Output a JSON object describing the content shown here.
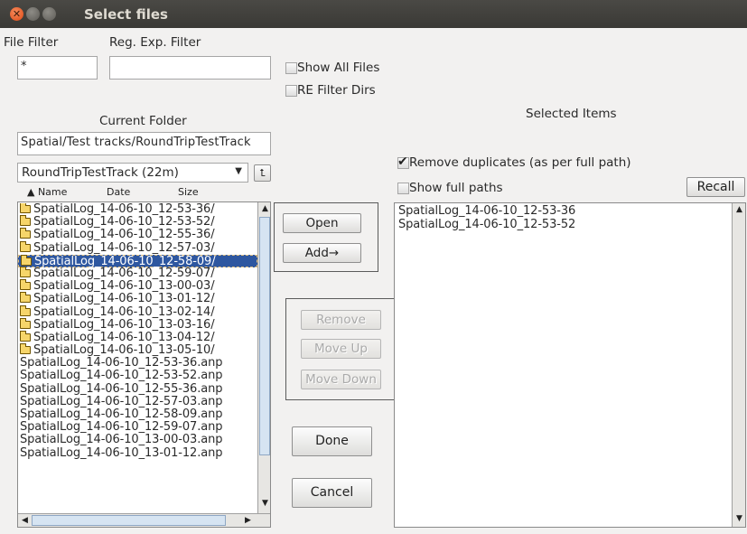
{
  "window": {
    "title": "Select files",
    "close_glyph": "✕"
  },
  "filters": {
    "file_filter_label": "File Filter",
    "regexp_filter_label": "Reg. Exp. Filter",
    "file_filter_value": "*",
    "regexp_filter_value": "",
    "show_all_files_label": "Show All Files",
    "show_all_files_checked": false,
    "re_filter_dirs_label": "RE Filter Dirs",
    "re_filter_dirs_checked": false
  },
  "current_folder": {
    "label": "Current Folder",
    "path": "Spatial/Test tracks/RoundTripTestTrack",
    "combo_value": "RoundTripTestTrack (22m)",
    "combo_arrow": "▼",
    "up_button_glyph": "⮤"
  },
  "file_list": {
    "columns": [
      "▲ Name",
      "Date",
      "Size"
    ],
    "rows": [
      {
        "text": "SpatialLog_14-06-10_12-53-36/",
        "folder": true,
        "selected": false
      },
      {
        "text": "SpatialLog_14-06-10_12-53-52/",
        "folder": true,
        "selected": false
      },
      {
        "text": "SpatialLog_14-06-10_12-55-36/",
        "folder": true,
        "selected": false
      },
      {
        "text": "SpatialLog_14-06-10_12-57-03/",
        "folder": true,
        "selected": false
      },
      {
        "text": "SpatialLog_14-06-10_12-58-09/",
        "folder": true,
        "selected": true
      },
      {
        "text": "SpatialLog_14-06-10_12-59-07/",
        "folder": true,
        "selected": false
      },
      {
        "text": "SpatialLog_14-06-10_13-00-03/",
        "folder": true,
        "selected": false
      },
      {
        "text": "SpatialLog_14-06-10_13-01-12/",
        "folder": true,
        "selected": false
      },
      {
        "text": "SpatialLog_14-06-10_13-02-14/",
        "folder": true,
        "selected": false
      },
      {
        "text": "SpatialLog_14-06-10_13-03-16/",
        "folder": true,
        "selected": false
      },
      {
        "text": "SpatialLog_14-06-10_13-04-12/",
        "folder": true,
        "selected": false
      },
      {
        "text": "SpatialLog_14-06-10_13-05-10/",
        "folder": true,
        "selected": false
      },
      {
        "text": "SpatialLog_14-06-10_12-53-36.anp",
        "folder": false,
        "selected": false
      },
      {
        "text": "SpatialLog_14-06-10_12-53-52.anp",
        "folder": false,
        "selected": false
      },
      {
        "text": "SpatialLog_14-06-10_12-55-36.anp",
        "folder": false,
        "selected": false
      },
      {
        "text": "SpatialLog_14-06-10_12-57-03.anp",
        "folder": false,
        "selected": false
      },
      {
        "text": "SpatialLog_14-06-10_12-58-09.anp",
        "folder": false,
        "selected": false
      },
      {
        "text": "SpatialLog_14-06-10_12-59-07.anp",
        "folder": false,
        "selected": false
      },
      {
        "text": "SpatialLog_14-06-10_13-00-03.anp",
        "folder": false,
        "selected": false
      },
      {
        "text": "SpatialLog_14-06-10_13-01-12.anp",
        "folder": false,
        "selected": false
      }
    ]
  },
  "actions": {
    "open_label": "Open",
    "add_label": "Add→",
    "remove_label": "Remove",
    "move_up_label": "Move Up",
    "move_down_label": "Move Down",
    "done_label": "Done",
    "cancel_label": "Cancel"
  },
  "selected": {
    "title": "Selected Items",
    "remove_duplicates_label": "Remove duplicates (as per full path)",
    "remove_duplicates_checked": true,
    "show_full_paths_label": "Show full paths",
    "show_full_paths_checked": false,
    "recall_label": "Recall",
    "items": [
      "SpatialLog_14-06-10_12-53-36",
      "SpatialLog_14-06-10_12-53-52"
    ]
  },
  "icons": {
    "close": "close-icon",
    "folder": "folder-icon",
    "scroll_up": "▲",
    "scroll_down": "▼",
    "scroll_left": "◀",
    "scroll_right": "▶"
  },
  "colors": {
    "selection": "#2e57a0",
    "titlebar": "#3c3b37",
    "close_button": "#e9541f"
  }
}
